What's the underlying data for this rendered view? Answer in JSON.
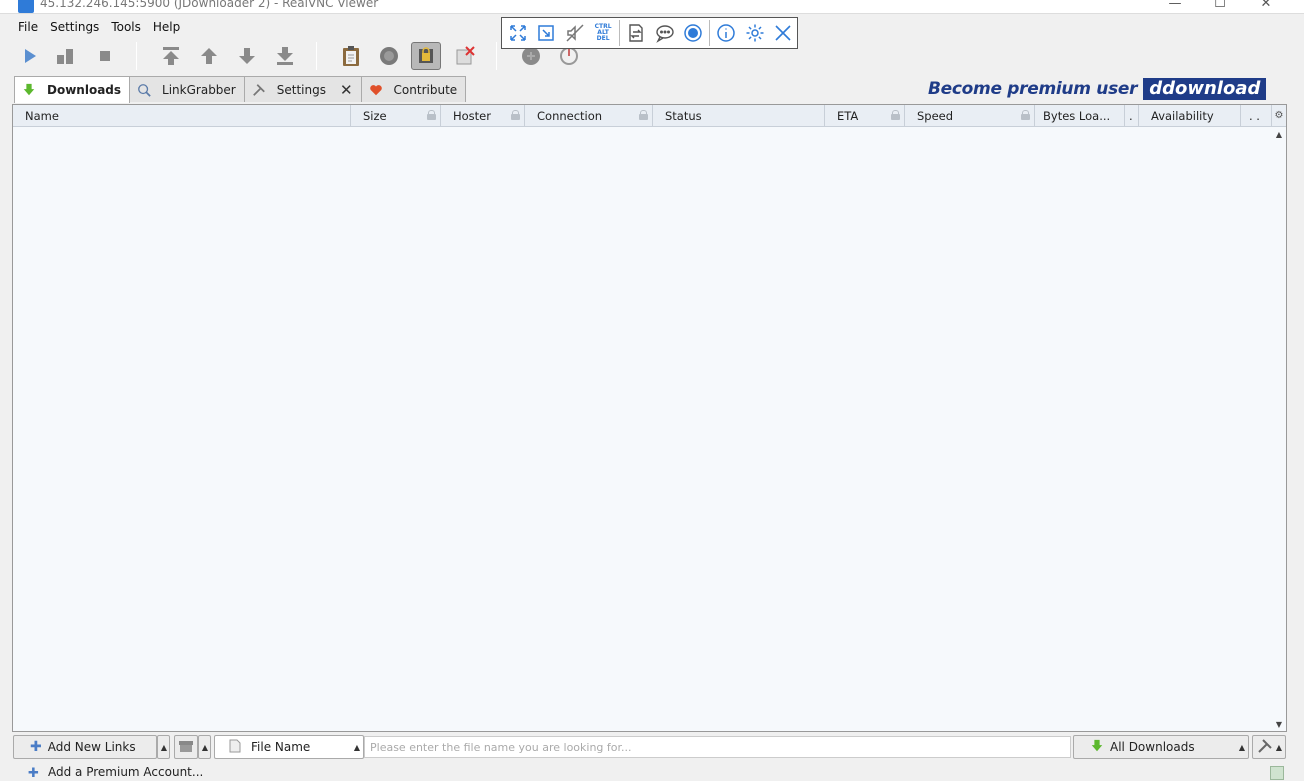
{
  "window": {
    "title": "45.132.246.145:5900 (JDownloader 2) - RealVNC Viewer",
    "controls": [
      "minimize",
      "maximize",
      "close"
    ]
  },
  "vnc_toolbar": {
    "buttons": [
      {
        "name": "fullscreen-icon"
      },
      {
        "name": "scale-icon"
      },
      {
        "name": "mute-icon"
      },
      {
        "name": "ctrl-alt-del-icon",
        "label": "CTRL ALT DEL"
      },
      {
        "name": "transfer-icon"
      },
      {
        "name": "chat-icon"
      },
      {
        "name": "record-icon"
      },
      {
        "name": "info-icon"
      },
      {
        "name": "settings-icon"
      },
      {
        "name": "close-icon"
      }
    ],
    "cad_lines": [
      "CTRL",
      "ALT",
      "DEL"
    ]
  },
  "menu": {
    "file": "File",
    "settings": "Settings",
    "tools": "Tools",
    "help": "Help"
  },
  "tabs": [
    {
      "label": "Downloads",
      "icon": "download-arrow-icon",
      "active": true
    },
    {
      "label": "LinkGrabber",
      "icon": "linkgrabber-icon",
      "active": false
    },
    {
      "label": "Settings",
      "icon": "tools-icon",
      "active": false,
      "closable": true
    },
    {
      "label": "Contribute",
      "icon": "heart-icon",
      "active": false
    }
  ],
  "banner": {
    "text": "Become premium user",
    "logo": "ddownload"
  },
  "table": {
    "columns": [
      "Name",
      "Size",
      "Hoster",
      "Connection",
      "Status",
      "ETA",
      "Speed",
      "Bytes Loa...",
      "Availability"
    ],
    "rows": []
  },
  "bottom": {
    "add_links": "Add New Links",
    "search_field": "File Name",
    "search_placeholder": "Please enter the file name you are looking for...",
    "view_filter": "All Downloads"
  },
  "status": {
    "add_premium": "Add a Premium Account..."
  },
  "colors": {
    "accent": "#2f7bd8",
    "banner_blue": "#1f3c88",
    "table_bg": "#f6f9fc"
  }
}
